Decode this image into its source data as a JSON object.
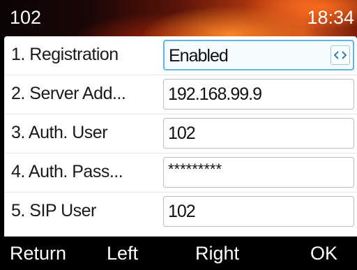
{
  "header": {
    "extension": "102",
    "time": "18:34"
  },
  "rows": [
    {
      "label": "1. Registration",
      "value": "Enabled"
    },
    {
      "label": "2. Server Add...",
      "value": "192.168.99.9"
    },
    {
      "label": "3. Auth. User",
      "value": "102"
    },
    {
      "label": "4. Auth. Pass...",
      "value": "*********"
    },
    {
      "label": "5. SIP User",
      "value": "102"
    }
  ],
  "softkeys": {
    "return": "Return",
    "left": "Left",
    "right": "Right",
    "ok": "OK"
  },
  "icons": {
    "selector_arrows": "left-right-arrows-icon"
  },
  "colors": {
    "selected_border": "#5fb7e0",
    "header_accent": "#d4541a"
  }
}
